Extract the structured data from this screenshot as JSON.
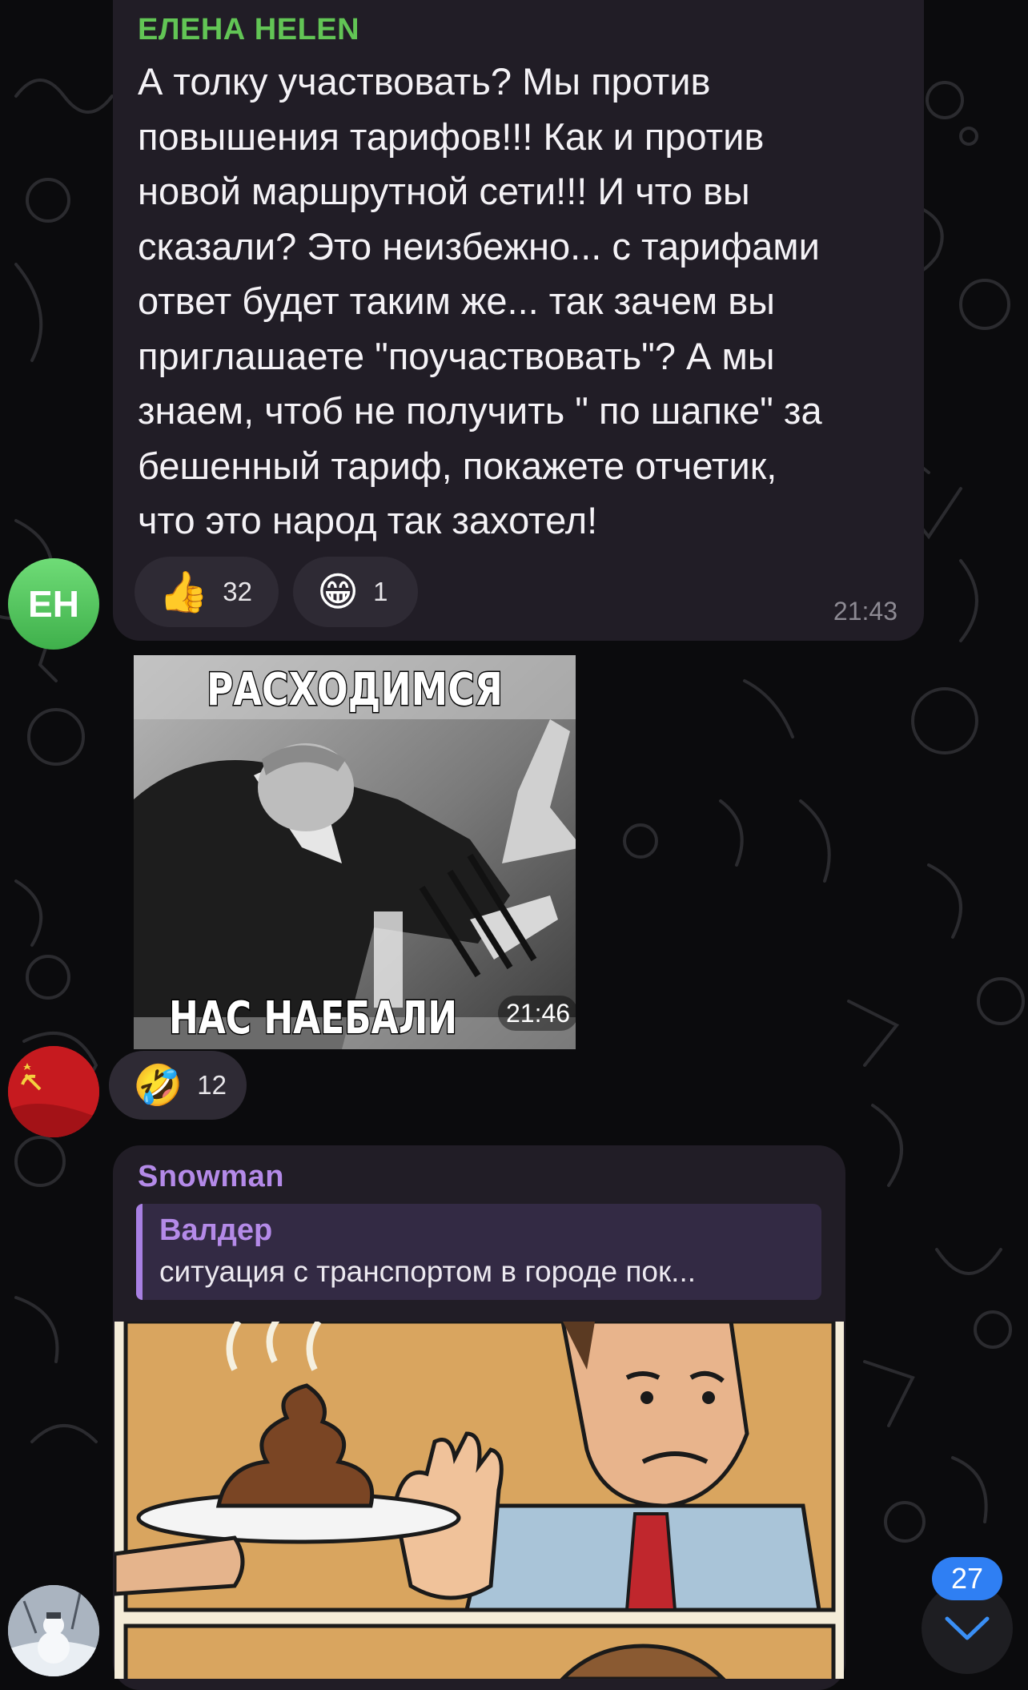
{
  "messages": [
    {
      "sender": "ЕЛЕНА HELEN",
      "avatar_initials": "EH",
      "text_lines": [
        "А толку участвовать? Мы против",
        "повышения тарифов!!! Как и против",
        "новой маршрутной сети!!! И что вы",
        "сказали? Это неизбежно... с тарифами",
        "ответ будет таким же... так зачем вы",
        "приглашаете \"поучаствовать\"? А мы",
        "знаем, чтоб не получить \" по шапке\" за",
        "бешенный тариф, покажете отчетик,",
        "что это народ так захотел!"
      ],
      "reactions": [
        {
          "emoji": "👍",
          "icon": "thumbs-up-icon",
          "count": "32"
        },
        {
          "emoji": "😁",
          "icon": "grinning-face-icon",
          "count": "1"
        }
      ],
      "time": "21:43"
    },
    {
      "type": "image",
      "image": {
        "top_text": "РАСХОДИМСЯ",
        "bottom_text": "НАС НАЕБАЛИ"
      },
      "avatar_icon": "ussr-flag-icon",
      "reactions": [
        {
          "emoji": "🤣",
          "icon": "rolling-laughing-icon",
          "count": "12"
        }
      ],
      "time": "21:46"
    },
    {
      "sender": "Snowman",
      "reply": {
        "author": "Валдер",
        "text": "ситуация с транспортом в городе пок..."
      },
      "image_icon": "comic-refusing-poop-image",
      "avatar_icon": "snowman-avatar"
    }
  ],
  "scroll_down": {
    "unread_count": "27",
    "icon": "chevron-down-icon"
  },
  "colors": {
    "background": "#0b0b0d",
    "bubble": "#211d26",
    "sender_green": "#62c555",
    "sender_purple": "#b48ae8",
    "reply_bg": "#332a44",
    "badge_blue": "#2f7ff3"
  }
}
